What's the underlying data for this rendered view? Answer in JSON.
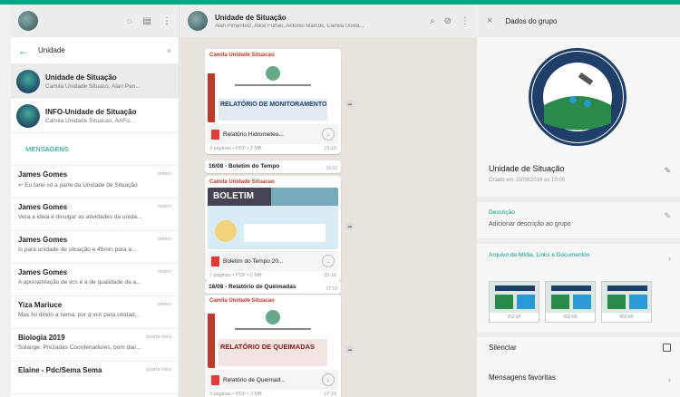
{
  "left": {
    "search": {
      "value": "Unidade"
    },
    "chats": [
      {
        "title": "Unidade de Situação",
        "preview": "Camila Unidade Situaco, Alan Pen..."
      },
      {
        "title": "INFO-Unidade de Situação",
        "preview": "Camila Unidade Situacao, AAFo..."
      }
    ],
    "section_title": "MENSAGENS",
    "messages": [
      {
        "name": "James Gomes",
        "date": "ontem",
        "preview": "↩ Eu farei só a parte da Unidade de Situação"
      },
      {
        "name": "James Gomes",
        "date": "ontem",
        "preview": "Vera a ideia é divulgar as atividades da unida..."
      },
      {
        "name": "James Gomes",
        "date": "ontem",
        "preview": "Is para unidade de situação e 45min para a..."
      },
      {
        "name": "James Gomes",
        "date": "ontem",
        "preview": "A apresentação de vcs é a de qualidade da a..."
      },
      {
        "name": "Yiza Mariuce",
        "date": "ontem",
        "preview": "Mas foi direto a sema, por q vcn para unidad..."
      },
      {
        "name": "Biologia 2019",
        "date": "quarta-feira",
        "preview": "Solange: Prezadas Coordenadores, bom dia!..."
      },
      {
        "name": "Elaine - Pdc/Sema Sema",
        "date": "quarta-feira",
        "preview": ""
      }
    ]
  },
  "middle": {
    "header": {
      "title": "Unidade de Situação",
      "subtitle": "Alan Pimentel2, Alice Furtao, Antonio Marcos, Camila Unida..."
    },
    "posts": [
      {
        "sender": "Camila Unidade Situacao",
        "thumb_title": "RELATÓRIO DE MONITORAMENTO",
        "file": "Relatório Hidrometeo...",
        "meta": "3 páginas • PDF • 2 MB",
        "time": "15:15"
      },
      {
        "sender": "Camila Unidade Situacao",
        "thumb_title": "BOLETIM",
        "file": "Boletim do Tempo 20...",
        "meta": "7 páginas • PDF • 2 MB",
        "time": "15:16"
      },
      {
        "sender": "Camila Unidade Situacao",
        "thumb_title": "RELATÓRIO DE QUEIMADAS",
        "file": "Relatório de Queimad...",
        "meta": "3 páginas • PDF • 2 MB",
        "time": "17:10"
      }
    ],
    "texts": [
      {
        "text": "16/08 - Boletim do Tempo",
        "time": "15:16"
      },
      {
        "text": "16/08 - Relatório de Queimadas",
        "time": "17:10"
      }
    ]
  },
  "right": {
    "title": "Dados do grupo",
    "group_name": "Unidade de Situação",
    "created": "Criado em 10/08/2016 às 10:00",
    "description_label": "Descrição",
    "description_value": "Adicionar descrição ao grupo",
    "media_label": "Arquivo de Mídia, Links e Documentos",
    "media_sizes": [
      "950 kB",
      "950 kB",
      "950 kB"
    ],
    "mute_label": "Silenciar",
    "starred_label": "Mensagens favoritas"
  },
  "colors": {
    "accent": "#00a884",
    "highlight": "#06a08a",
    "pdf": "#e53935"
  }
}
